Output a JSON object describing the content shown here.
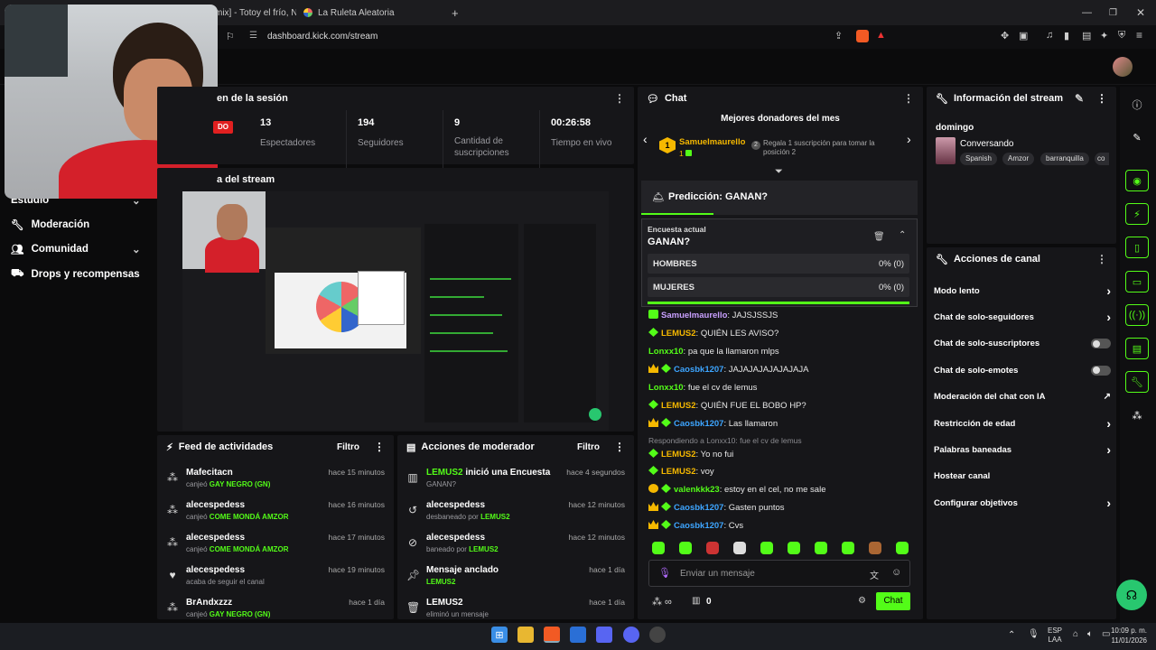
{
  "browser": {
    "tab1": "mix] - Totoy el frío, No",
    "tab2": "La Ruleta Aleatoria",
    "url": "dashboard.kick.com/stream"
  },
  "sidebar": {
    "items": [
      {
        "label": "Estudio"
      },
      {
        "label": "Moderación"
      },
      {
        "label": "Comunidad"
      },
      {
        "label": "Drops y recompensas"
      }
    ]
  },
  "session": {
    "title": "en de la sesión",
    "live_badge": "DO",
    "stats": [
      {
        "value": "13",
        "label": "Espectadores"
      },
      {
        "value": "194",
        "label": "Seguidores"
      },
      {
        "value": "9",
        "label": "Cantidad de suscripciones"
      },
      {
        "value": "00:26:58",
        "label": "Tiempo en vivo"
      }
    ]
  },
  "preview": {
    "title": "a del stream"
  },
  "feed": {
    "title": "Feed de actividades",
    "filter": "Filtro",
    "rows": [
      {
        "name": "Mafecitacn",
        "pre": "canjeó ",
        "hl": "GAY NEGRO (GN)",
        "time": "hace 15 minutos",
        "icon": "redeem-icon"
      },
      {
        "name": "alecespedess",
        "pre": "canjeó ",
        "hl": "COME MONDÁ AMZOR",
        "time": "hace 16 minutos",
        "icon": "redeem-icon"
      },
      {
        "name": "alecespedess",
        "pre": "canjeó ",
        "hl": "COME MONDÁ AMZOR",
        "time": "hace 17 minutos",
        "icon": "redeem-icon"
      },
      {
        "name": "alecespedess",
        "pre": "acaba de seguir el canal",
        "hl": "",
        "time": "hace 19 minutos",
        "icon": "heart-icon"
      },
      {
        "name": "BrAndxzzz",
        "pre": "canjeó ",
        "hl": "GAY NEGRO (GN)",
        "time": "hace 1 día",
        "icon": "redeem-icon"
      }
    ]
  },
  "modactions": {
    "title": "Acciones de moderador",
    "filter": "Filtro",
    "rows": [
      {
        "name_hl": "LEMUS2",
        "name_rest": " inició una Encuesta",
        "sub_pre": "GANAN?",
        "sub_hl": "",
        "time": "hace 4 segundos"
      },
      {
        "name_hl": "",
        "name_rest": "alecespedess",
        "sub_pre": "desbaneado por ",
        "sub_hl": "LEMUS2",
        "time": "hace 12 minutos"
      },
      {
        "name_hl": "",
        "name_rest": "alecespedess",
        "sub_pre": "baneado por ",
        "sub_hl": "LEMUS2",
        "time": "hace 12 minutos"
      },
      {
        "name_hl": "",
        "name_rest": "Mensaje anclado",
        "sub_pre": "",
        "sub_hl": "LEMUS2",
        "time": "hace 1 día"
      },
      {
        "name_hl": "",
        "name_rest": "LEMUS2",
        "sub_pre": "eliminó un mensaje",
        "sub_hl": "",
        "time": "hace 1 día"
      }
    ]
  },
  "chat": {
    "title": "Chat",
    "donors_title": "Mejores donadores del mes",
    "donor_rank": "1",
    "donor_name": "Samuelmaurello",
    "donor_count": "1",
    "gift_rank": "2",
    "gift_text": "Regala 1 suscripción para tomar la posición 2",
    "prediction_title": "Predicción: GANAN?",
    "poll_label": "Encuesta actual",
    "poll_question": "GANAN?",
    "options": [
      {
        "label": "HOMBRES",
        "pct": "0% (0)"
      },
      {
        "label": "MUJERES",
        "pct": "0% (0)"
      }
    ],
    "messages": [
      {
        "user": "Samuelmaurello",
        "color": "#c9a0ff",
        "text": ": JAJSJSSJS",
        "badges": "green"
      },
      {
        "user": "LEMUS2",
        "color": "#f5b800",
        "text": ": QUIÉN LES AVISO?",
        "badges": "mod"
      },
      {
        "user": "Lonxx10",
        "color": "#53fc18",
        "text": ": pa que la llamaron mlps",
        "badges": ""
      },
      {
        "user": "Caosbk1207",
        "color": "#3da5ff",
        "text": ": JAJAJAJAJAJAJAJA",
        "badges": "crown"
      },
      {
        "user": "Lonxx10",
        "color": "#53fc18",
        "text": ": fue el cv de lemus",
        "badges": ""
      },
      {
        "user": "LEMUS2",
        "color": "#f5b800",
        "text": ": QUIÉN FUE EL BOBO HP?",
        "badges": "mod"
      },
      {
        "user": "Caosbk1207",
        "color": "#3da5ff",
        "text": ": Las llamaron",
        "badges": "crown"
      },
      {
        "user": "LEMUS2",
        "color": "#f5b800",
        "text": ": Yo no fui",
        "badges": "mod"
      },
      {
        "user": "LEMUS2",
        "color": "#f5b800",
        "text": ": voy",
        "badges": "mod"
      },
      {
        "user": "valenkkk23",
        "color": "#53fc18",
        "text": ": estoy en el cel, no me sale",
        "badges": "sub"
      },
      {
        "user": "Caosbk1207",
        "color": "#3da5ff",
        "text": ": Gasten puntos",
        "badges": "crown"
      },
      {
        "user": "Caosbk1207",
        "color": "#3da5ff",
        "text": ": Cvs",
        "badges": "crown"
      }
    ],
    "reply_note": "Respondiendo a Lonxx10: fue el cv de lemus",
    "input_placeholder": "Enviar un mensaje",
    "points": "0",
    "send_label": "Chat"
  },
  "stream_info": {
    "title": "Información del stream",
    "stream_title": "domingo",
    "category": "Conversando",
    "tags": [
      "Spanish",
      "Amzor",
      "barranquilla",
      "co"
    ]
  },
  "channel_actions": {
    "title": "Acciones de canal",
    "items": [
      {
        "label": "Modo lento",
        "control": "chevron"
      },
      {
        "label": "Chat de solo-seguidores",
        "control": "chevron"
      },
      {
        "label": "Chat de solo-suscriptores",
        "control": "toggle"
      },
      {
        "label": "Chat de solo-emotes",
        "control": "toggle"
      },
      {
        "label": "Moderación del chat con IA",
        "control": "external"
      },
      {
        "label": "Restricción de edad",
        "control": "chevron"
      },
      {
        "label": "Palabras baneadas",
        "control": "chevron"
      },
      {
        "label": "Hostear canal",
        "control": "none"
      },
      {
        "label": "Configurar objetivos",
        "control": "chevron"
      }
    ]
  },
  "taskbar": {
    "lang": "ESP",
    "lang2": "LAA",
    "time": "10:09 p. m.",
    "date": "11/01/2026"
  },
  "colors": {
    "accent": "#53fc18",
    "panel": "#161619",
    "bg": "#0b0b0c"
  }
}
